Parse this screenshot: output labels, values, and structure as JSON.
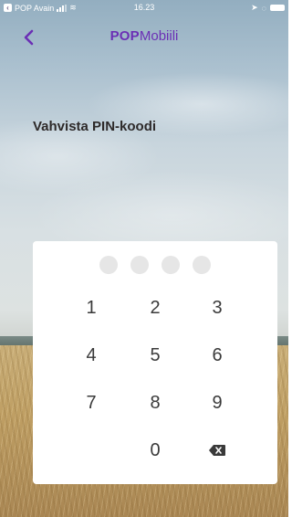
{
  "status_bar": {
    "carrier": "POP Avain",
    "time": "16.23"
  },
  "nav": {
    "brand_bold": "POP",
    "brand_regular": "Mobiili",
    "back_icon": "chevron-left-icon"
  },
  "heading": "Vahvista PIN-koodi",
  "pin_dots": {
    "total": 4,
    "filled": 0
  },
  "keypad": {
    "keys": [
      "1",
      "2",
      "3",
      "4",
      "5",
      "6",
      "7",
      "8",
      "9",
      "0"
    ],
    "backspace_icon": "backspace-icon"
  },
  "colors": {
    "brand": "#6b2fb5",
    "heading": "#2e2a2a",
    "dot_empty": "#e6e6e6"
  }
}
